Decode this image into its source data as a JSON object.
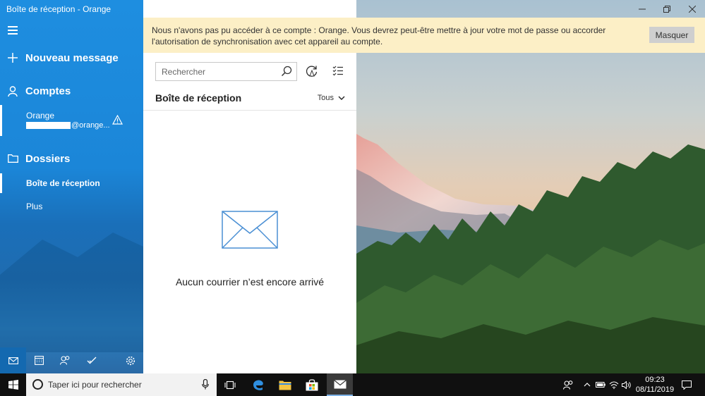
{
  "window": {
    "title": "Boîte de réception - Orange"
  },
  "sidebar": {
    "new_message": "Nouveau message",
    "accounts_heading": "Comptes",
    "account": {
      "name": "Orange",
      "email_suffix": "@orange..."
    },
    "folders_heading": "Dossiers",
    "folders": [
      {
        "label": "Boîte de réception",
        "selected": true
      },
      {
        "label": "Plus"
      }
    ],
    "bottom_icons": [
      "mail-icon",
      "calendar-icon",
      "people-icon",
      "todo-icon",
      "settings-icon"
    ]
  },
  "list": {
    "search_placeholder": "Rechercher",
    "title": "Boîte de réception",
    "filter": "Tous",
    "empty_message": "Aucun courrier n’est encore arrivé"
  },
  "notification": {
    "text": "Nous n'avons pas pu accéder à ce compte : Orange. Vous devrez peut-être mettre à jour votre mot de passe ou accorder l'autorisation de synchronisation avec cet appareil au compte.",
    "dismiss_label": "Masquer"
  },
  "taskbar": {
    "search_placeholder": "Taper ici pour rechercher",
    "time": "09:23",
    "date": "08/11/2019"
  },
  "colors": {
    "accent": "#1e8ee0",
    "notification_bg": "#fcefc6",
    "taskbar": "#101010"
  }
}
